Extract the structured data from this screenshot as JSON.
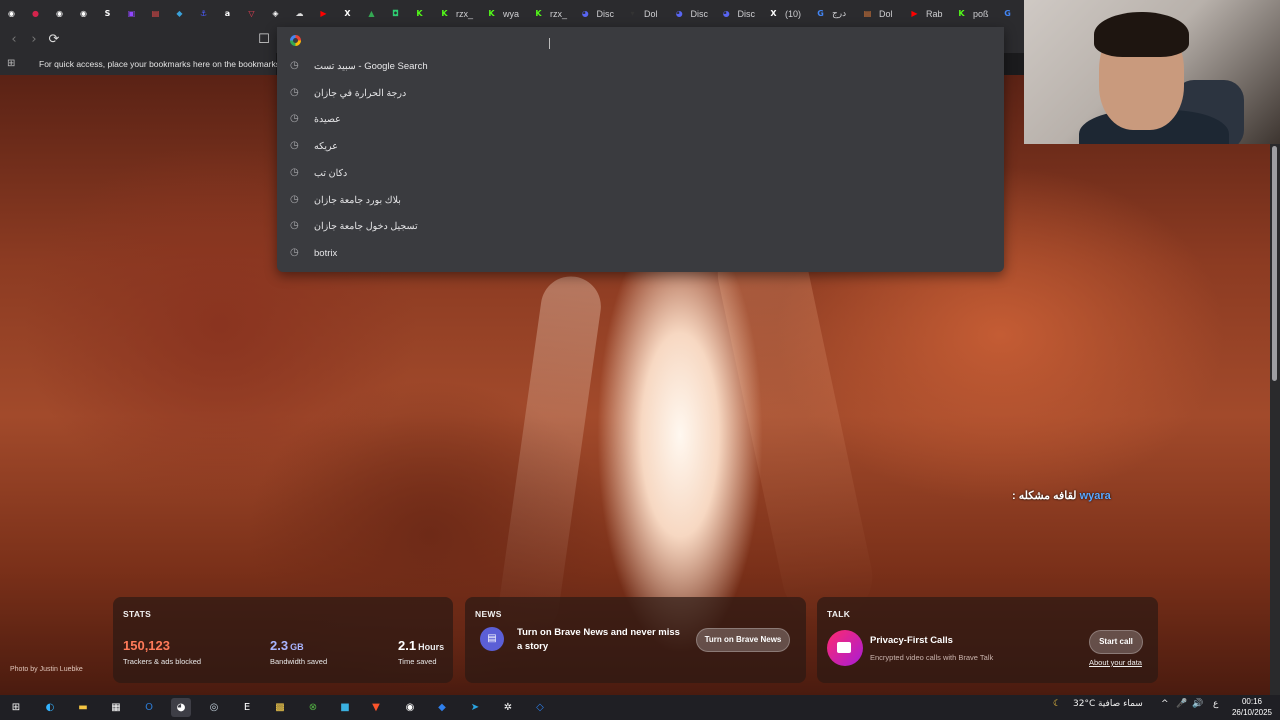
{
  "tabs": [
    {
      "label": "",
      "icon": "chrome-icon",
      "color": "#ffffff",
      "glyph": "◉"
    },
    {
      "label": "",
      "icon": "red-circle-icon",
      "color": "#d4244c",
      "glyph": "●"
    },
    {
      "label": "",
      "icon": "chrome-icon",
      "color": "#ffffff",
      "glyph": "◉"
    },
    {
      "label": "",
      "icon": "chrome-icon",
      "color": "#ffffff",
      "glyph": "◉"
    },
    {
      "label": "",
      "icon": "sync-icon",
      "color": "#ffffff",
      "glyph": "S"
    },
    {
      "label": "",
      "icon": "twitch-icon",
      "color": "#9146ff",
      "glyph": "▣"
    },
    {
      "label": "",
      "icon": "bag-icon",
      "color": "#f24b4b",
      "glyph": "▤"
    },
    {
      "label": "",
      "icon": "cube-icon",
      "color": "#3aa1d9",
      "glyph": "◆"
    },
    {
      "label": "",
      "icon": "anchor-icon",
      "color": "#4b5cff",
      "glyph": "⚓"
    },
    {
      "label": "",
      "icon": "amazon-icon",
      "color": "#ffffff",
      "glyph": "a"
    },
    {
      "label": "",
      "icon": "pocket-icon",
      "color": "#ef4056",
      "glyph": "▽"
    },
    {
      "label": "",
      "icon": "diamond-icon",
      "color": "#ffffff",
      "glyph": "◈"
    },
    {
      "label": "",
      "icon": "cloud-icon",
      "color": "#dddddd",
      "glyph": "☁"
    },
    {
      "label": "",
      "icon": "youtube-icon",
      "color": "#ff0000",
      "glyph": "▶"
    },
    {
      "label": "",
      "icon": "x-icon",
      "color": "#ffffff",
      "glyph": "X"
    },
    {
      "label": "",
      "icon": "drive-icon",
      "color": "#34a853",
      "glyph": "▲"
    },
    {
      "label": "",
      "icon": "green-app-icon",
      "color": "#2ecc71",
      "glyph": "◘"
    },
    {
      "label": "",
      "icon": "kick-icon",
      "color": "#53fc18",
      "glyph": "K"
    },
    {
      "label": "rzx_",
      "icon": "kick-icon",
      "color": "#53fc18",
      "glyph": "K"
    },
    {
      "label": "wya",
      "icon": "kick-icon",
      "color": "#53fc18",
      "glyph": "K"
    },
    {
      "label": "rzx_",
      "icon": "kick-icon",
      "color": "#53fc18",
      "glyph": "K"
    },
    {
      "label": "Disc",
      "icon": "discord-icon",
      "color": "#5865f2",
      "glyph": "◕"
    },
    {
      "label": "Dol",
      "icon": "dol-icon",
      "color": "#333333",
      "glyph": "▾"
    },
    {
      "label": "Disc",
      "icon": "discord-icon",
      "color": "#5865f2",
      "glyph": "◕"
    },
    {
      "label": "Disc",
      "icon": "discord-icon",
      "color": "#5865f2",
      "glyph": "◕"
    },
    {
      "label": "(10)",
      "icon": "x-icon",
      "color": "#ffffff",
      "glyph": "X"
    },
    {
      "label": "درج",
      "icon": "google-icon",
      "color": "#4285f4",
      "glyph": "G"
    },
    {
      "label": "Dol",
      "icon": "bag-icon",
      "color": "#e07b39",
      "glyph": "▤"
    },
    {
      "label": "Rab",
      "icon": "youtube-icon",
      "color": "#ff0000",
      "glyph": "▶"
    },
    {
      "label": "poß",
      "icon": "kick-icon",
      "color": "#53fc18",
      "glyph": "K"
    },
    {
      "label": "",
      "icon": "google-icon",
      "color": "#4285f4",
      "glyph": "G"
    }
  ],
  "toolbar": {
    "back_glyph": "‹",
    "forward_glyph": "›",
    "reload_glyph": "⟳",
    "bookmark_glyph": "☐"
  },
  "bookmarks_bar": {
    "apps_glyph": "⊞",
    "hint": "For quick access, place your bookmarks here on the bookmarks bar"
  },
  "omnibox": {
    "suggestions": [
      "سبيد تست - Google Search",
      "درجة الحرارة في جازان",
      "عصيدة",
      "عريكه",
      "دكان تب",
      "بلاك بورد جامعة جازان",
      "تسجيل دخول جامعة جازان",
      "botrix"
    ]
  },
  "overlay_text": {
    "accent": "wyara",
    "rest": " لقافه مشكله : "
  },
  "photo_credit": "Photo by Justin Luebke",
  "widgets": {
    "stats": {
      "title": "STATS",
      "trackers": {
        "value": "150,123",
        "label": "Trackers & ads blocked",
        "color": "#ff7a59"
      },
      "bandwidth": {
        "value": "2.3",
        "unit": "GB",
        "label": "Bandwidth saved",
        "color": "#a9b5ff"
      },
      "time": {
        "value": "2.1",
        "unit": "Hours",
        "label": "Time saved",
        "color": "#ffffff"
      }
    },
    "news": {
      "title": "NEWS",
      "text": "Turn on Brave News and never miss a story",
      "button": "Turn on Brave News"
    },
    "talk": {
      "title": "TALK",
      "heading": "Privacy-First Calls",
      "sub": "Encrypted video calls with Brave Talk",
      "button": "Start call",
      "link": "About your data"
    }
  },
  "taskbar": {
    "apps": [
      {
        "name": "start-icon",
        "glyph": "⊞",
        "color": "#ffffff"
      },
      {
        "name": "edge-icon",
        "glyph": "◐",
        "color": "#33b3ff"
      },
      {
        "name": "file-explorer-icon",
        "glyph": "▬",
        "color": "#f5c542"
      },
      {
        "name": "store-icon",
        "glyph": "▦",
        "color": "#ffffff"
      },
      {
        "name": "outlook-icon",
        "glyph": "O",
        "color": "#2d7cd6"
      },
      {
        "name": "discord-icon",
        "glyph": "◕",
        "color": "#ffffff"
      },
      {
        "name": "steam-icon",
        "glyph": "◎",
        "color": "#c7d5e0"
      },
      {
        "name": "epic-games-icon",
        "glyph": "E",
        "color": "#ffffff"
      },
      {
        "name": "game-icon",
        "glyph": "▩",
        "color": "#ffd54f"
      },
      {
        "name": "xbox-icon",
        "glyph": "⊗",
        "color": "#52b043"
      },
      {
        "name": "app-icon",
        "glyph": "■",
        "color": "#3ab0e0"
      },
      {
        "name": "brave-icon",
        "glyph": "▼",
        "color": "#fb542b"
      },
      {
        "name": "obs-icon",
        "glyph": "◉",
        "color": "#ffffff"
      },
      {
        "name": "blue-app-icon",
        "glyph": "◆",
        "color": "#2f80ed"
      },
      {
        "name": "telegram-icon",
        "glyph": "➤",
        "color": "#2aa3e0"
      },
      {
        "name": "settings-icon",
        "glyph": "✲",
        "color": "#ffffff"
      },
      {
        "name": "remote-icon",
        "glyph": "◇",
        "color": "#2f80ed"
      }
    ],
    "weather": {
      "temp": "32°C",
      "condition": "سماء صافية"
    },
    "tray_icons": [
      "^",
      "🎤",
      "🔊",
      "ع"
    ],
    "time": "00:16",
    "date": "26/10/2025"
  }
}
